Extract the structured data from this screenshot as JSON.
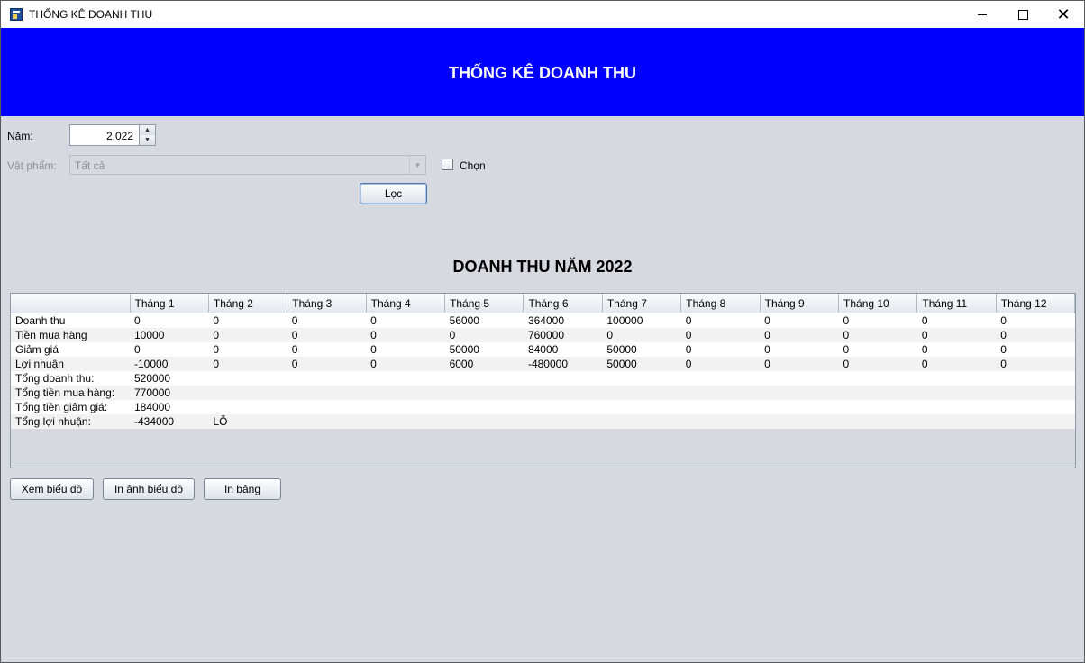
{
  "window": {
    "title": "THỐNG KÊ DOANH THU",
    "close_glyph": "✕"
  },
  "header": {
    "title": "THỐNG KÊ DOANH THU",
    "background": "#0000ff"
  },
  "filters": {
    "year_label": "Năm:",
    "year_value": "2,022",
    "item_label": "Vật phẩm:",
    "item_value": "Tất cả",
    "choose_label": "Chọn",
    "choose_checked": false,
    "filter_button": "Lọc"
  },
  "section_title": "DOANH THU NĂM 2022",
  "table": {
    "columns": [
      "",
      "Tháng 1",
      "Tháng 2",
      "Tháng 3",
      "Tháng 4",
      "Tháng 5",
      "Tháng 6",
      "Tháng 7",
      "Tháng 8",
      "Tháng 9",
      "Tháng 10",
      "Tháng 11",
      "Tháng 12"
    ],
    "rows": [
      [
        "Doanh thu",
        "0",
        "0",
        "0",
        "0",
        "56000",
        "364000",
        "100000",
        "0",
        "0",
        "0",
        "0",
        "0"
      ],
      [
        "Tiền mua hàng",
        "10000",
        "0",
        "0",
        "0",
        "0",
        "760000",
        "0",
        "0",
        "0",
        "0",
        "0",
        "0"
      ],
      [
        "Giảm giá",
        "0",
        "0",
        "0",
        "0",
        "50000",
        "84000",
        "50000",
        "0",
        "0",
        "0",
        "0",
        "0"
      ],
      [
        "Lợi nhuận",
        "-10000",
        "0",
        "0",
        "0",
        "6000",
        "-480000",
        "50000",
        "0",
        "0",
        "0",
        "0",
        "0"
      ],
      [
        "Tổng doanh thu:",
        "520000",
        "",
        "",
        "",
        "",
        "",
        "",
        "",
        "",
        "",
        "",
        ""
      ],
      [
        "Tổng tiền mua hàng:",
        "770000",
        "",
        "",
        "",
        "",
        "",
        "",
        "",
        "",
        "",
        "",
        ""
      ],
      [
        "Tổng tiền giảm giá:",
        "184000",
        "",
        "",
        "",
        "",
        "",
        "",
        "",
        "",
        "",
        "",
        ""
      ],
      [
        "Tổng lợi nhuận:",
        "-434000",
        "LỖ",
        "",
        "",
        "",
        "",
        "",
        "",
        "",
        "",
        "",
        ""
      ]
    ]
  },
  "actions": {
    "view_chart": "Xem biểu đồ",
    "print_chart_image": "In ảnh biểu đồ",
    "print_table": "In bảng"
  }
}
